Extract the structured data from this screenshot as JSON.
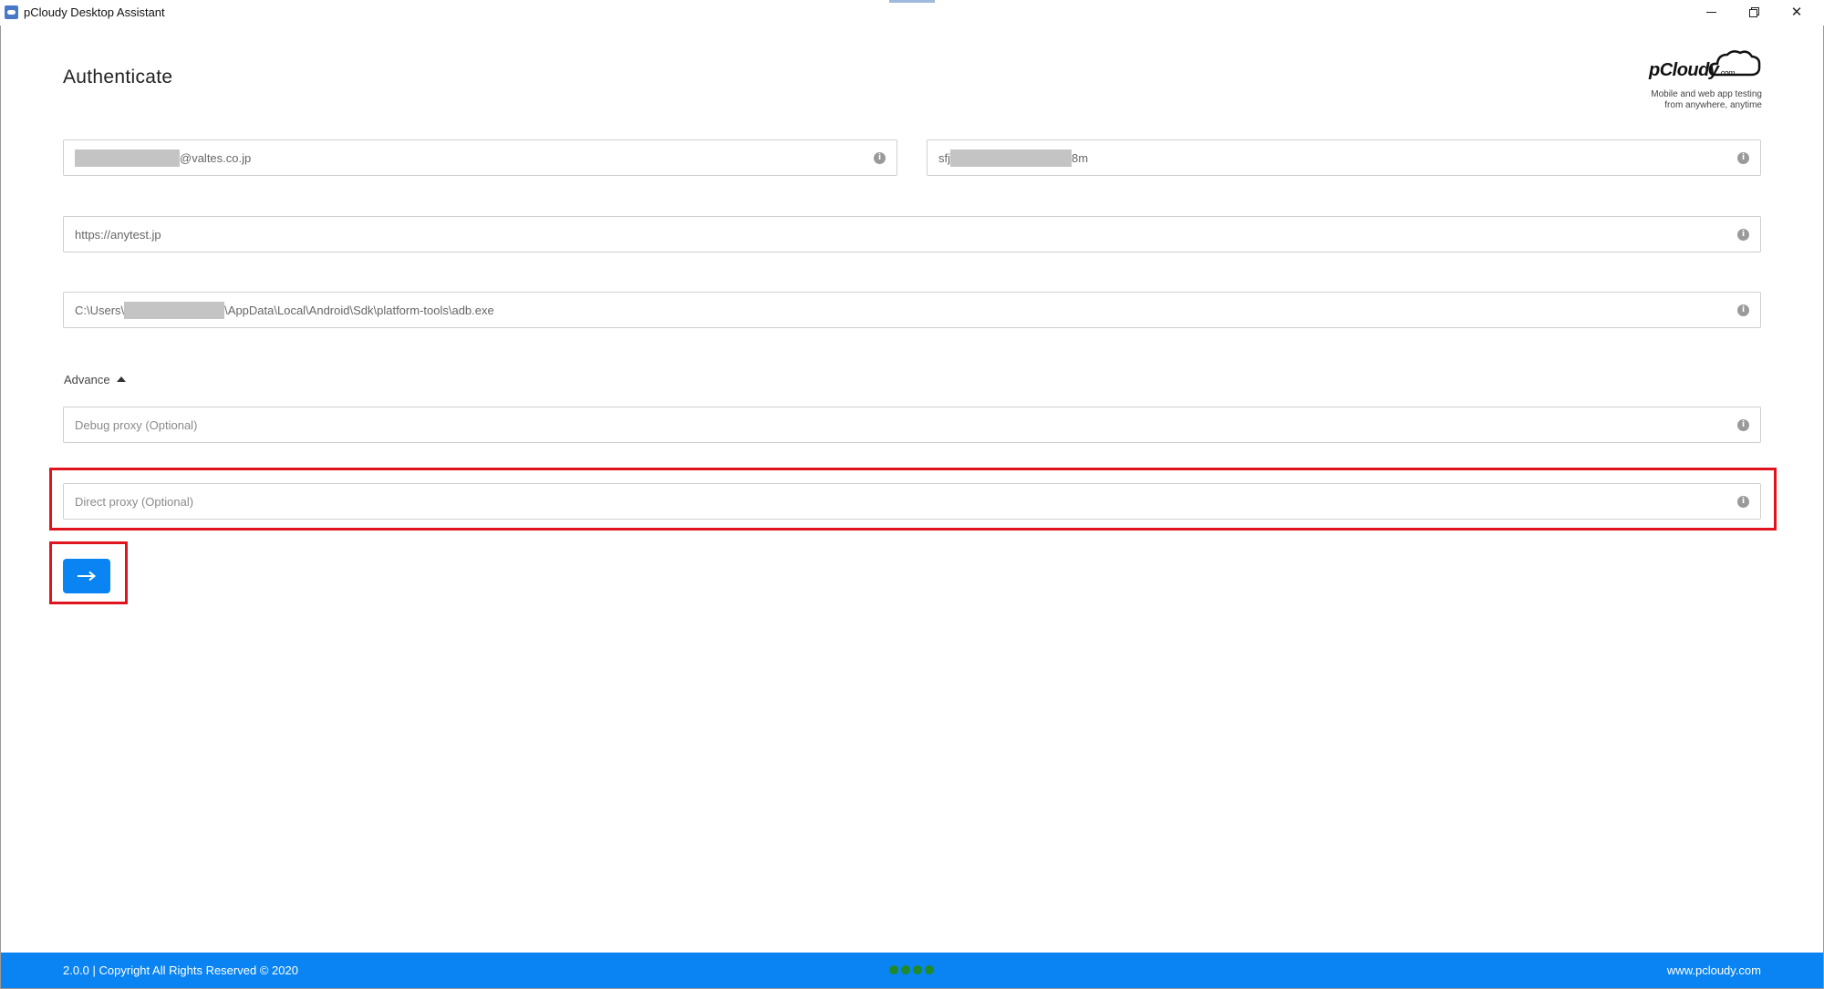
{
  "window": {
    "title": "pCloudy Desktop Assistant"
  },
  "header": {
    "title": "Authenticate",
    "logo_text": "pCloudy",
    "logo_domain": ".com",
    "tagline_line1": "Mobile and web app testing",
    "tagline_line2": "from anywhere, anytime"
  },
  "form": {
    "email": {
      "visible_suffix": "@valtes.co.jp",
      "redacted": true
    },
    "api_key": {
      "visible_prefix": "sfj",
      "visible_suffix": "8m",
      "redacted": true
    },
    "url": {
      "value": "https://anytest.jp"
    },
    "adb_path": {
      "prefix": "C:\\Users\\",
      "suffix": "\\AppData\\Local\\Android\\Sdk\\platform-tools\\adb.exe",
      "redacted": true
    },
    "advance_label": "Advance",
    "debug_proxy": {
      "placeholder": "Debug proxy (Optional)"
    },
    "direct_proxy": {
      "placeholder": "Direct proxy (Optional)"
    },
    "info_icon_glyph": "i",
    "submit_icon": "arrow-right-icon"
  },
  "footer": {
    "copyright": "2.0.0 | Copyright All Rights Reserved © 2020",
    "website": "www.pcloudy.com",
    "status_dots": 4,
    "status_color": "#1f8a2a"
  },
  "colors": {
    "accent": "#0a84f2",
    "highlight": "#e0141e"
  }
}
